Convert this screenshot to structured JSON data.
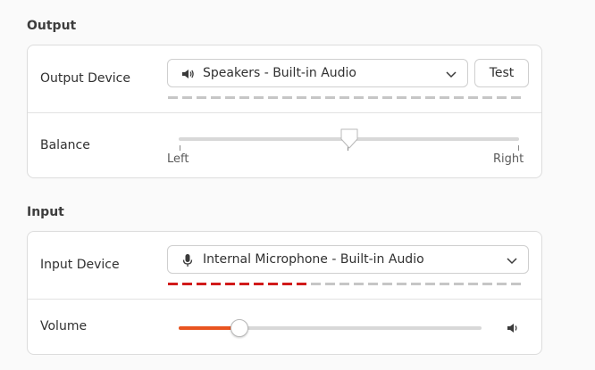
{
  "output": {
    "section_title": "Output",
    "device_label": "Output Device",
    "device_value": "Speakers - Built-in Audio",
    "device_icon": "speaker-icon",
    "test_button": "Test",
    "level": 0.0,
    "balance_label": "Balance",
    "balance_left": "Left",
    "balance_right": "Right",
    "balance_value": 0.5
  },
  "input": {
    "section_title": "Input",
    "device_label": "Input Device",
    "device_value": "Internal Microphone - Built-in Audio",
    "device_icon": "microphone-icon",
    "level": 0.4,
    "volume_label": "Volume",
    "volume_value": 0.2,
    "volume_icon": "speaker-icon"
  },
  "colors": {
    "accent": "#e95420",
    "level_active": "#d11a1a",
    "level_inactive": "#c6c6c6"
  }
}
